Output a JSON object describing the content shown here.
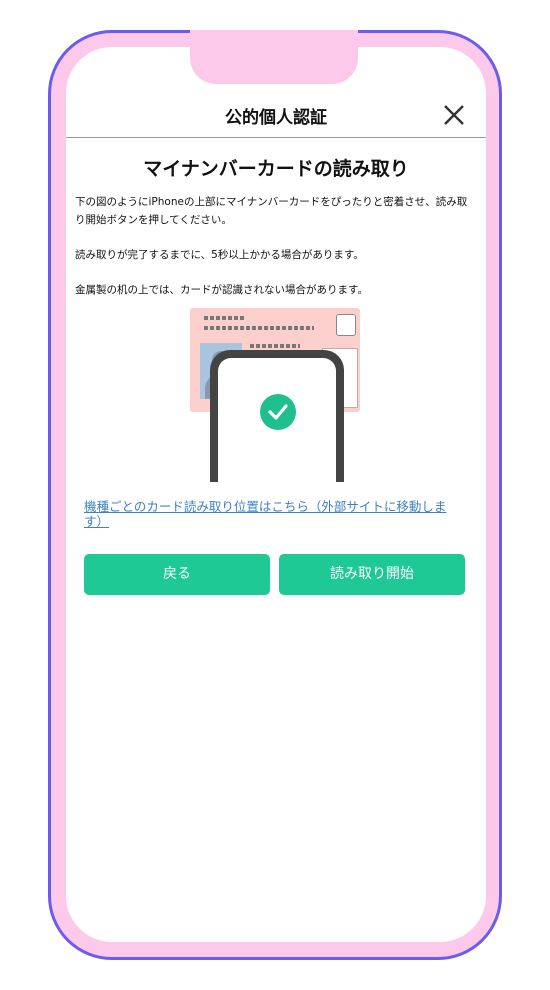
{
  "header": {
    "title": "公的個人認証",
    "close_icon": "close-icon"
  },
  "heading": "マイナンバーカードの読み取り",
  "paragraphs": [
    "下の図のようにiPhoneの上部にマイナンバーカードをぴったりと密着させ、読み取り開始ボタンを押してください。",
    "読み取りが完了するまでに、5秒以上かかる場合があります。",
    "金属製の机の上では、カードが認識されない場合があります。"
  ],
  "link_text": "機種ごとのカード読み取り位置はこちら（外部サイトに移動します）",
  "buttons": {
    "back": "戻る",
    "start": "読み取り開始"
  },
  "colors": {
    "accent_green": "#1fc996",
    "frame_pink": "#fcc9ea",
    "frame_border": "#6a5cf0",
    "link_blue": "#3d82c4"
  }
}
